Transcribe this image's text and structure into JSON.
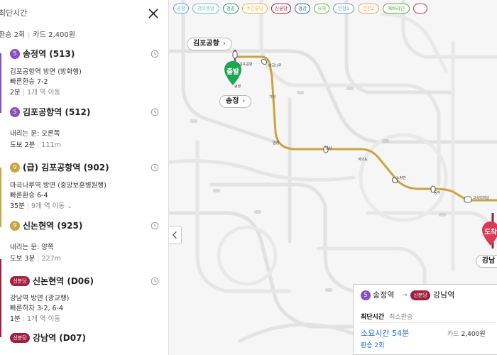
{
  "colors": {
    "line5": "#8b4fbd",
    "line9": "#c9a441",
    "shinbundang": "#a3203b",
    "start_marker": "#1ea650",
    "end_marker": "#d93b57",
    "accent_blue": "#1d6fd1"
  },
  "panel": {
    "title": "최단시간",
    "close_icon": "close-icon",
    "summary": {
      "transfer": "환승 2회",
      "fare": "카드 2,400원"
    }
  },
  "stops": [
    {
      "badge": "5",
      "name": "송정역 (513)",
      "details": [
        "김포공항역 방면 (방화행)",
        "빠른환승 7-2"
      ],
      "time": "2분",
      "extra": "1개 역 이동"
    },
    {
      "badge": "5",
      "name": "김포공항역 (512)",
      "details": [
        "내리는 문: 오른쪽"
      ],
      "time": "도보 2분",
      "extra": "111m"
    },
    {
      "badge": "9",
      "name": "(급) 김포공항역 (902)",
      "details": [
        "마곡나루역 방면 (중앙보훈병원행)",
        "빠른환승 6-4"
      ],
      "time": "35분",
      "extra": "9개 역 이동"
    },
    {
      "badge": "9",
      "name": "신논현역 (925)",
      "details": [
        "내리는 문: 양쪽"
      ],
      "time": "도보 3분",
      "extra": "227m"
    },
    {
      "badge": "신분당",
      "name": "신논현역 (D06)",
      "details": [
        "강남역 방면 (광교행)",
        "빠른하차 3-2, 6-4"
      ],
      "time": "1분",
      "extra": "1개 역 이동"
    },
    {
      "badge": "신분당",
      "name": "강남역 (D07)"
    }
  ],
  "map": {
    "filter_chips": [
      {
        "label": "공항",
        "color": "#5da6d9"
      },
      {
        "label": "경의중앙",
        "color": "#6fc3b1"
      },
      {
        "label": "경춘",
        "color": "#2d9b78"
      },
      {
        "label": "수인분당",
        "color": "#e7b532"
      },
      {
        "label": "신분당",
        "color": "#a3203b"
      },
      {
        "label": "경강",
        "color": "#2864b4"
      },
      {
        "label": "서해",
        "color": "#7ab542"
      },
      {
        "label": "인천1",
        "color": "#6c9bd2"
      },
      {
        "label": "인천2",
        "color": "#f1a34a"
      },
      {
        "label": "에버라인",
        "color": "#5ba34a"
      },
      {
        "label": "",
        "color": "#c0393b"
      }
    ],
    "start_callout": "김포공항",
    "start_marker": "출발",
    "songjeong_callout": "송정",
    "end_marker": "도착",
    "end_callout": "강남",
    "station_labels": [
      "김포공항",
      "송정",
      "마곡나루",
      "가양",
      "염창",
      "당산",
      "여의도",
      "노량진",
      "동작",
      "고속터미널"
    ],
    "collapse_icon": "chevron-left-icon"
  },
  "route_card": {
    "from_badge": "5",
    "from": "송정역",
    "to_badge": "신분당",
    "to": "강남역",
    "tabs": [
      "최단시간",
      "최소환승"
    ],
    "time": "소요시간 54분",
    "fare_label": "카드",
    "fare": "2,400원",
    "transfers": "환승 2회"
  }
}
